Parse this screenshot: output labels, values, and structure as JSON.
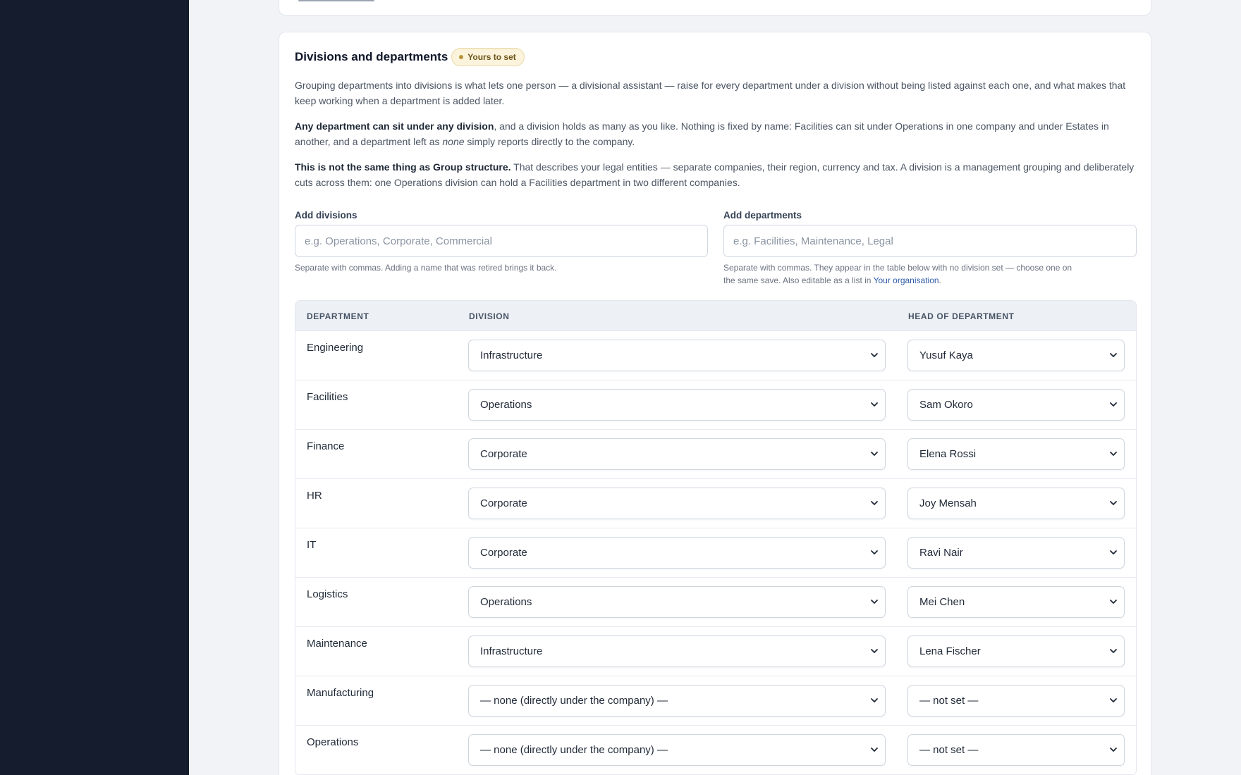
{
  "card": {
    "title": "Divisions and departments",
    "badge": "Yours to set",
    "para1": "Grouping departments into divisions is what lets one person — a divisional assistant — raise for every department under a division without being listed against each one, and what makes that keep working when a department is added later.",
    "para2_bold": "Any department can sit under any division",
    "para2_a": ", and a division holds as many as you like. Nothing is fixed by name: Facilities can sit under Operations in one company and under Estates in another, and a department left as ",
    "para2_italic": "none",
    "para2_b": " simply reports directly to the company.",
    "para3_bold": "This is not the same thing as Group structure.",
    "para3_rest": " That describes your legal entities — separate companies, their region, currency and tax. A division is a management grouping and deliberately cuts across them: one Operations division can hold a Facilities department in two different companies."
  },
  "add_divisions": {
    "label": "Add divisions",
    "placeholder": "e.g. Operations, Corporate, Commercial",
    "hint": "Separate with commas. Adding a name that was retired brings it back."
  },
  "add_departments": {
    "label": "Add departments",
    "placeholder": "e.g. Facilities, Maintenance, Legal",
    "hint_line1": "Separate with commas. They appear in the table below with no division set — choose one on",
    "hint_line2": "the same save. Also editable as a list in ",
    "hint_link": "Your organisation",
    "hint_end": "."
  },
  "table": {
    "headers": {
      "department": "DEPARTMENT",
      "division": "DIVISION",
      "head": "HEAD OF DEPARTMENT"
    },
    "rows": [
      {
        "department": "Engineering",
        "division": "Infrastructure",
        "head": "Yusuf Kaya"
      },
      {
        "department": "Facilities",
        "division": "Operations",
        "head": "Sam Okoro"
      },
      {
        "department": "Finance",
        "division": "Corporate",
        "head": "Elena Rossi"
      },
      {
        "department": "HR",
        "division": "Corporate",
        "head": "Joy Mensah"
      },
      {
        "department": "IT",
        "division": "Corporate",
        "head": "Ravi Nair"
      },
      {
        "department": "Logistics",
        "division": "Operations",
        "head": "Mei Chen"
      },
      {
        "department": "Maintenance",
        "division": "Infrastructure",
        "head": "Lena Fischer"
      },
      {
        "department": "Manufacturing",
        "division": "— none (directly under the company) —",
        "head": "— not set —"
      },
      {
        "department": "Operations",
        "division": "— none (directly under the company) —",
        "head": "— not set —"
      }
    ]
  },
  "colors": {
    "sidebar": "#141c2e",
    "background": "#f1f3f7",
    "badge_bg": "#fbf3dc",
    "link": "#2f5aa8"
  }
}
